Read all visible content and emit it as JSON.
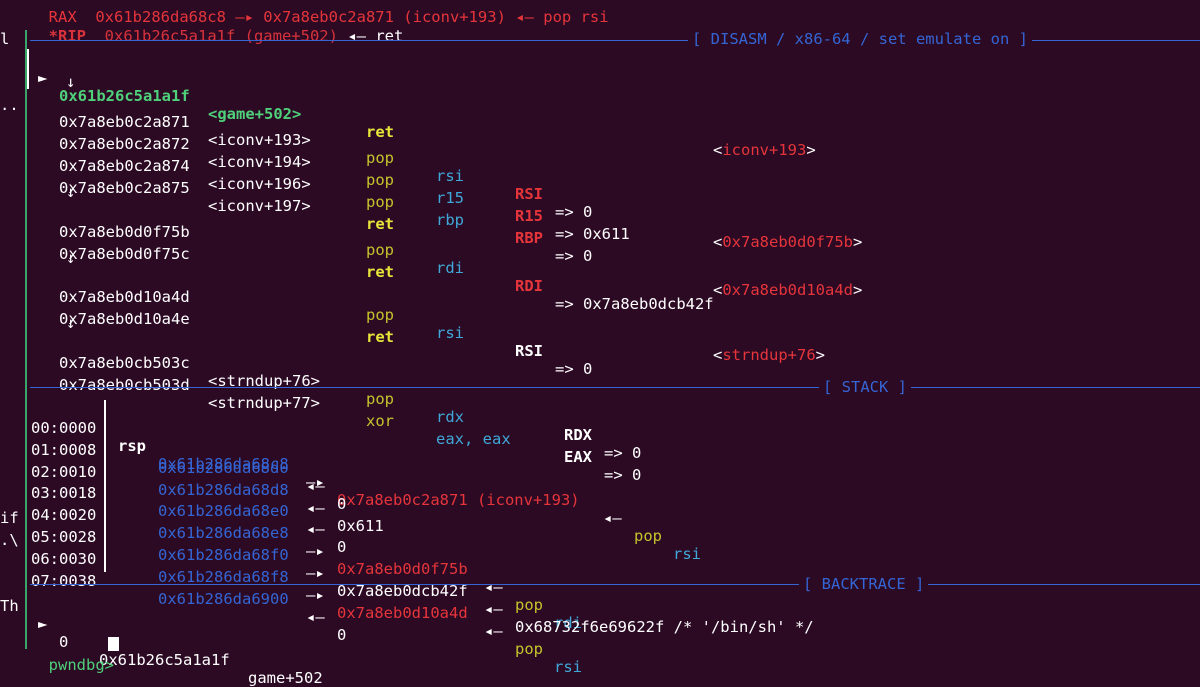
{
  "top_fragment": "RAX  0x61b286da68c8 —▸ 0x7a8eb0c2a871 (iconv+193) ◂— pop rsi",
  "rip": {
    "label": "*RIP",
    "value": "0x61b26c5a1a1f (game+502)",
    "arrow": "◂—",
    "target": "ret"
  },
  "sections": {
    "disasm": "[ DISASM / x86-64 / set emulate on ]",
    "stack": "[ STACK ]",
    "backtrace": "[ BACKTRACE ]"
  },
  "left_fragments": [
    "l",
    "..",
    "if",
    ".\\",
    "Th"
  ],
  "disasm": {
    "current": {
      "marker": "►",
      "addr": "0x61b26c5a1a1f",
      "sym": "<game+502>",
      "op": "ret",
      "target": "<iconv+193>"
    },
    "down_arrow": "↓",
    "rows": [
      {
        "addr": "0x7a8eb0c2a871",
        "sym": "<iconv+193>",
        "op": "pop",
        "arg": "rsi",
        "reg": "RSI",
        "val": "=> 0"
      },
      {
        "addr": "0x7a8eb0c2a872",
        "sym": "<iconv+194>",
        "op": "pop",
        "arg": "r15",
        "reg": "R15",
        "val": "=> 0x611"
      },
      {
        "addr": "0x7a8eb0c2a874",
        "sym": "<iconv+196>",
        "op": "pop",
        "arg": "rbp",
        "reg": "RBP",
        "val": "=> 0"
      },
      {
        "addr": "0x7a8eb0c2a875",
        "sym": "<iconv+197>",
        "op": "ret",
        "target": "<0x7a8eb0d0f75b>"
      },
      {
        "addr": "0x7a8eb0d0f75b",
        "sym": "",
        "op": "pop",
        "arg": "rdi",
        "reg": "RDI",
        "val": "=> 0x7a8eb0dcb42f"
      },
      {
        "addr": "0x7a8eb0d0f75c",
        "sym": "",
        "op": "ret",
        "target": "<0x7a8eb0d10a4d>"
      },
      {
        "addr": "0x7a8eb0d10a4d",
        "sym": "",
        "op": "pop",
        "arg": "rsi",
        "reg": "RSI",
        "val": "=> 0"
      },
      {
        "addr": "0x7a8eb0d10a4e",
        "sym": "",
        "op": "ret",
        "target_pre": "<",
        "target_sym": "strndup+76",
        "target_post": ">"
      },
      {
        "addr": "0x7a8eb0cb503c",
        "sym": "<strndup+76>",
        "op": "pop",
        "arg": "rdx",
        "reg": "RDX",
        "val": "=> 0"
      },
      {
        "addr": "0x7a8eb0cb503d",
        "sym": "<strndup+77>",
        "op": "xor",
        "arg": "eax, eax",
        "reg": "EAX",
        "val": "=> 0"
      }
    ]
  },
  "stack": [
    {
      "idx": "00:0000",
      "reg": "rsp",
      "addr": "0x61b286da68c8",
      "arrow": "—▸",
      "val": "0x7a8eb0c2a871 (iconv+193)",
      "arrow2": "◂—",
      "insn": "pop",
      "insn_arg": "rsi"
    },
    {
      "idx": "01:0008",
      "reg": "",
      "addr": "0x61b286da68d0",
      "arrow": "◂—",
      "val": "0"
    },
    {
      "idx": "02:0010",
      "reg": "",
      "addr": "0x61b286da68d8",
      "arrow": "◂—",
      "val": "0x611"
    },
    {
      "idx": "03:0018",
      "reg": "",
      "addr": "0x61b286da68e0",
      "arrow": "◂—",
      "val": "0"
    },
    {
      "idx": "04:0020",
      "reg": "",
      "addr": "0x61b286da68e8",
      "arrow": "—▸",
      "val": "0x7a8eb0d0f75b",
      "arrow2": "◂—",
      "insn": "pop",
      "insn_arg": "rdi"
    },
    {
      "idx": "05:0028",
      "reg": "",
      "addr": "0x61b286da68f0",
      "arrow": "—▸",
      "val": "0x7a8eb0dcb42f",
      "arrow2": "◂—",
      "extra": "0x68732f6e69622f /* '/bin/sh' */"
    },
    {
      "idx": "06:0030",
      "reg": "",
      "addr": "0x61b286da68f8",
      "arrow": "—▸",
      "val": "0x7a8eb0d10a4d",
      "arrow2": "◂—",
      "insn": "pop",
      "insn_arg": "rsi"
    },
    {
      "idx": "07:0038",
      "reg": "",
      "addr": "0x61b286da6900",
      "arrow": "◂—",
      "val": "0"
    }
  ],
  "backtrace": {
    "marker": "►",
    "frame": "0",
    "addr": "0x61b26c5a1a1f",
    "sym": "game+502"
  },
  "prompt": "pwndbg>",
  "colors": {
    "background": "#2c0a24",
    "separator": "#3465d4",
    "green": "#4fd07a",
    "yellow": "#c4c42c",
    "red": "#e5353b",
    "cyan": "#3fa8d8"
  }
}
